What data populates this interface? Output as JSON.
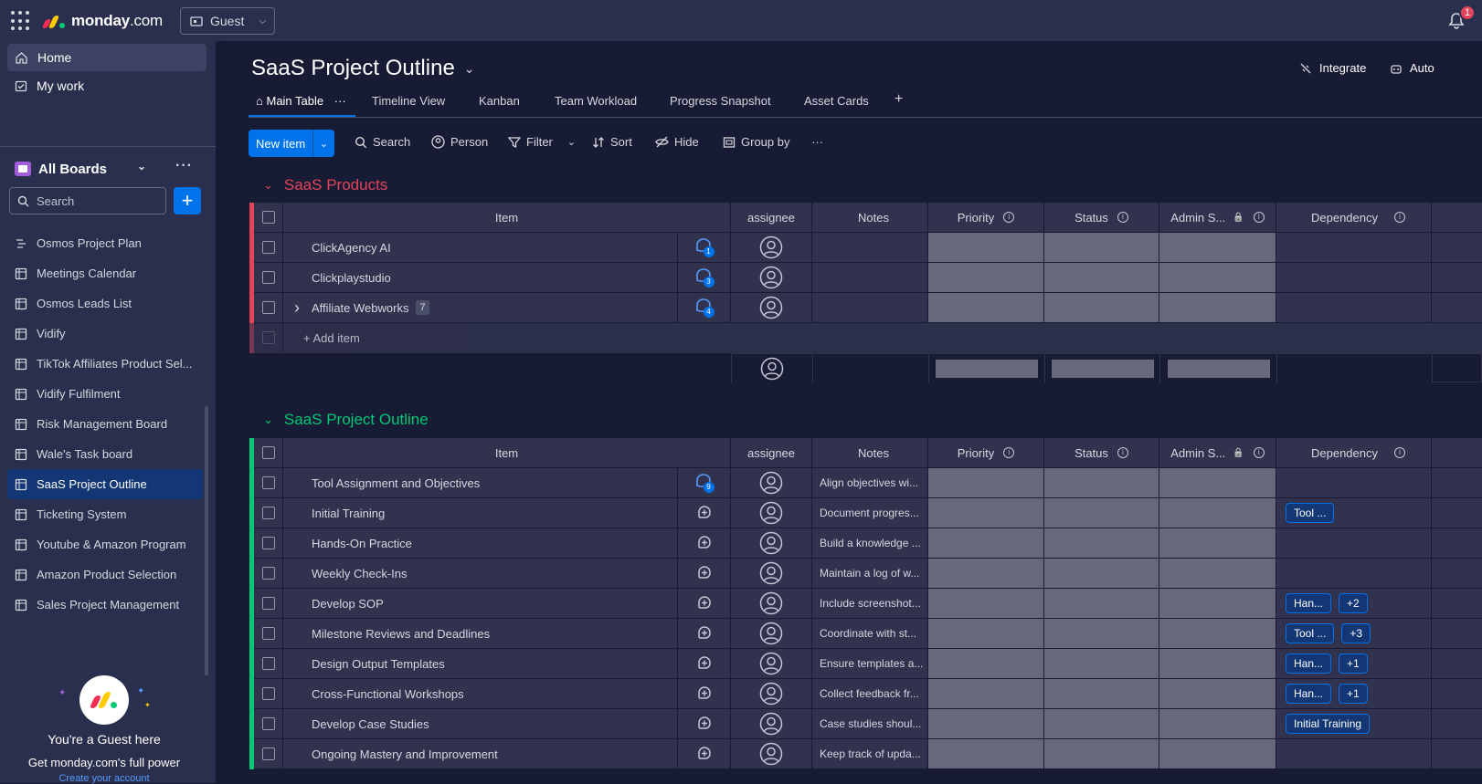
{
  "topbar": {
    "brand_bold": "monday",
    "brand_rest": ".com",
    "guest_label": "Guest",
    "notification_count": "1"
  },
  "sidebar": {
    "home": "Home",
    "my_work": "My work",
    "boards_title": "All Boards",
    "search_placeholder": "Search",
    "boards": [
      "Osmos Project Plan",
      "Meetings Calendar",
      "Osmos Leads List",
      "Vidify",
      "TikTok Affiliates Product Sel...",
      "Vidify Fulfilment",
      "Risk Management Board",
      "Wale's Task board",
      "SaaS Project Outline",
      "Ticketing System",
      "Youtube & Amazon Program",
      "Amazon Product Selection",
      "Sales Project Management"
    ],
    "active_board_index": 8,
    "guest_title": "You're a Guest here",
    "guest_subtitle": "Get monday.com's full power",
    "guest_link": "Create your account"
  },
  "board": {
    "title": "SaaS Project Outline",
    "integrate": "Integrate",
    "automate": "Auto",
    "tabs": [
      "Main Table",
      "Timeline View",
      "Kanban",
      "Team Workload",
      "Progress Snapshot",
      "Asset Cards",
      "+"
    ],
    "toolbar": {
      "new_item": "New item",
      "search": "Search",
      "person": "Person",
      "filter": "Filter",
      "sort": "Sort",
      "hide": "Hide",
      "group_by": "Group by",
      "more": "···"
    },
    "columns": {
      "item": "Item",
      "assignee": "assignee",
      "notes": "Notes",
      "priority": "Priority",
      "status": "Status",
      "admin": "Admin S...",
      "dependency": "Dependency"
    },
    "colors": {
      "group1": "#e2445c",
      "group2": "#00c875",
      "accent": "#0073ea"
    },
    "group1": {
      "name": "SaaS Products",
      "add_item": "+ Add item",
      "rows": [
        {
          "name": "ClickAgency AI",
          "updates": "1",
          "subitems": ""
        },
        {
          "name": "Clickplaystudio",
          "updates": "3",
          "subitems": ""
        },
        {
          "name": "Affiliate Webworks",
          "updates": "4",
          "subitems": "7"
        }
      ]
    },
    "group2": {
      "name": "SaaS Project Outline",
      "rows": [
        {
          "name": "Tool Assignment and Objectives",
          "updates": "9",
          "notes": "Align objectives wi...",
          "dep": "",
          "dep_more": ""
        },
        {
          "name": "Initial Training",
          "updates": "",
          "notes": "Document progres...",
          "dep": "Tool ...",
          "dep_more": ""
        },
        {
          "name": "Hands-On Practice",
          "updates": "",
          "notes": "Build a knowledge ...",
          "dep": "",
          "dep_more": ""
        },
        {
          "name": "Weekly Check-Ins",
          "updates": "",
          "notes": "Maintain a log of w...",
          "dep": "",
          "dep_more": ""
        },
        {
          "name": "Develop SOP",
          "updates": "",
          "notes": "Include screenshot...",
          "dep": "Han...",
          "dep_more": "+2"
        },
        {
          "name": "Milestone Reviews and Deadlines",
          "updates": "",
          "notes": "Coordinate with st...",
          "dep": "Tool ...",
          "dep_more": "+3"
        },
        {
          "name": "Design Output Templates",
          "updates": "",
          "notes": "Ensure templates a...",
          "dep": "Han...",
          "dep_more": "+1"
        },
        {
          "name": "Cross-Functional Workshops",
          "updates": "",
          "notes": "Collect feedback fr...",
          "dep": "Han...",
          "dep_more": "+1"
        },
        {
          "name": "Develop Case Studies",
          "updates": "",
          "notes": "Case studies shoul...",
          "dep": "Initial Training",
          "dep_more": ""
        },
        {
          "name": "Ongoing Mastery and Improvement",
          "updates": "",
          "notes": "Keep track of upda...",
          "dep": "",
          "dep_more": ""
        }
      ]
    }
  }
}
